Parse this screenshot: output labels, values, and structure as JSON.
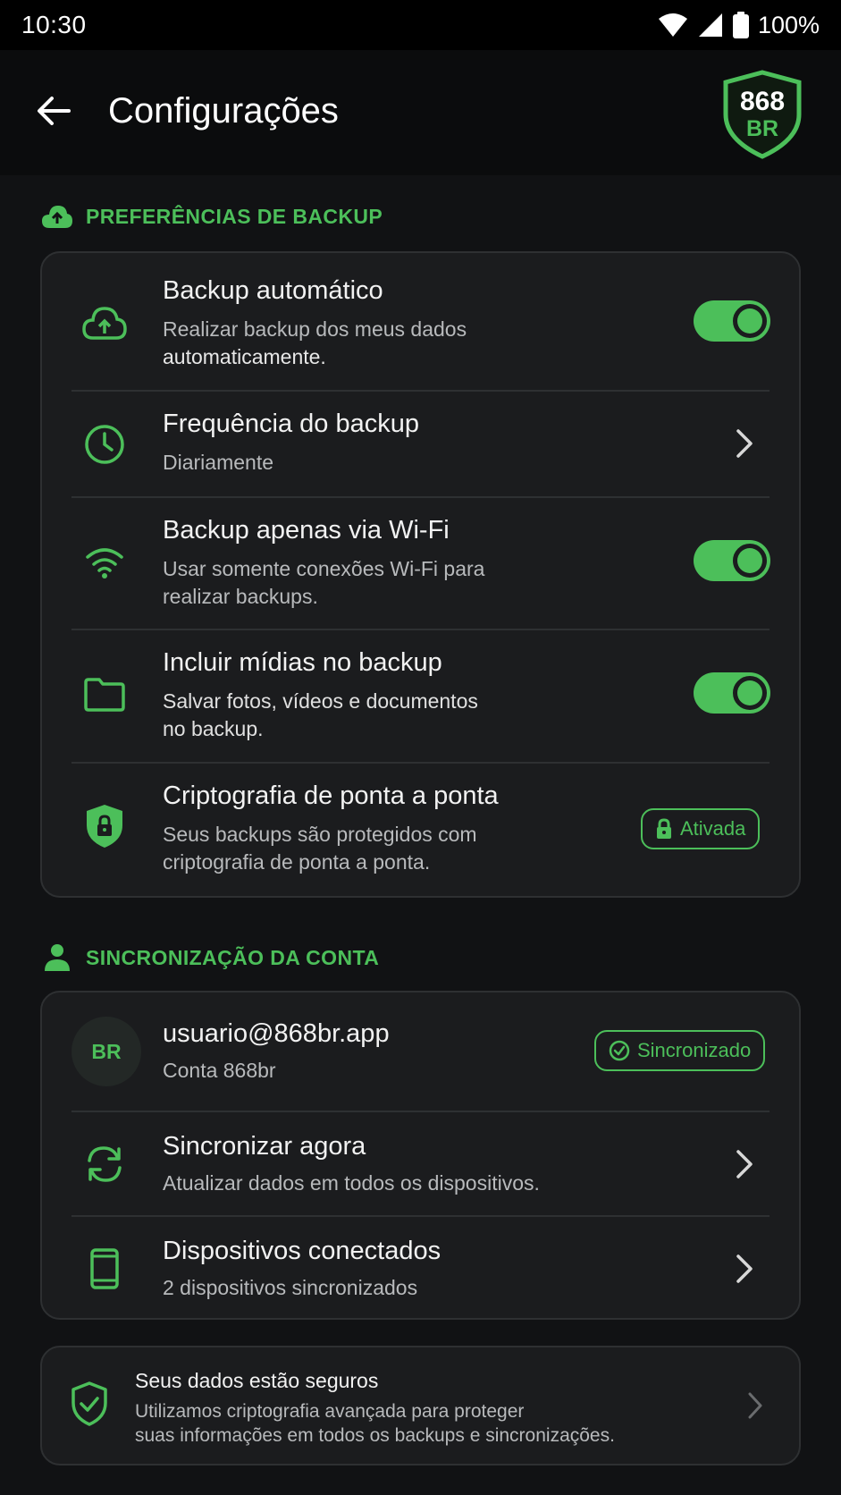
{
  "status_bar": {
    "time": "10:30",
    "battery": "100%"
  },
  "app_bar": {
    "title": "Configurações",
    "logo_top": "868",
    "logo_bottom": "BR"
  },
  "backup_section": {
    "title": "PREFERÊNCIAS DE BACKUP",
    "items": [
      {
        "title": "Backup automático",
        "sub1": "Realizar backup dos meus dados",
        "sub2": "automaticamente.",
        "toggle_on": true
      },
      {
        "title": "Frequência do backup",
        "sub1": "Diariamente"
      },
      {
        "title": "Backup apenas via Wi-Fi",
        "sub1": "Usar somente conexões Wi-Fi para",
        "sub2": "realizar backups.",
        "toggle_on": true
      },
      {
        "title": "Incluir mídias no backup",
        "sub1": "Salvar fotos, vídeos e documentos",
        "sub2": "no backup.",
        "toggle_on": true
      },
      {
        "title": "Criptografia de ponta a ponta",
        "sub1": "Seus backups são protegidos com",
        "sub2": "criptografia de ponta a ponta.",
        "badge": "Ativada"
      }
    ]
  },
  "account_section": {
    "title": "SINCRONIZAÇÃO DA CONTA",
    "account": {
      "avatar": "BR",
      "email": "usuario@868br.app",
      "name": "Conta 868br",
      "badge": "Sincronizado"
    },
    "items": [
      {
        "title": "Sincronizar agora",
        "sub1": "Atualizar dados em todos os dispositivos."
      },
      {
        "title": "Dispositivos conectados",
        "sub1": "2 dispositivos sincronizados"
      }
    ]
  },
  "info": {
    "title": "Seus dados estão seguros",
    "line1": "Utilizamos criptografia avançada para proteger",
    "line2": "suas informações em todos os backups e sincronizações."
  },
  "colors": {
    "accent": "#4cbf5a",
    "background": "#111214",
    "card": "#1b1c1e"
  }
}
